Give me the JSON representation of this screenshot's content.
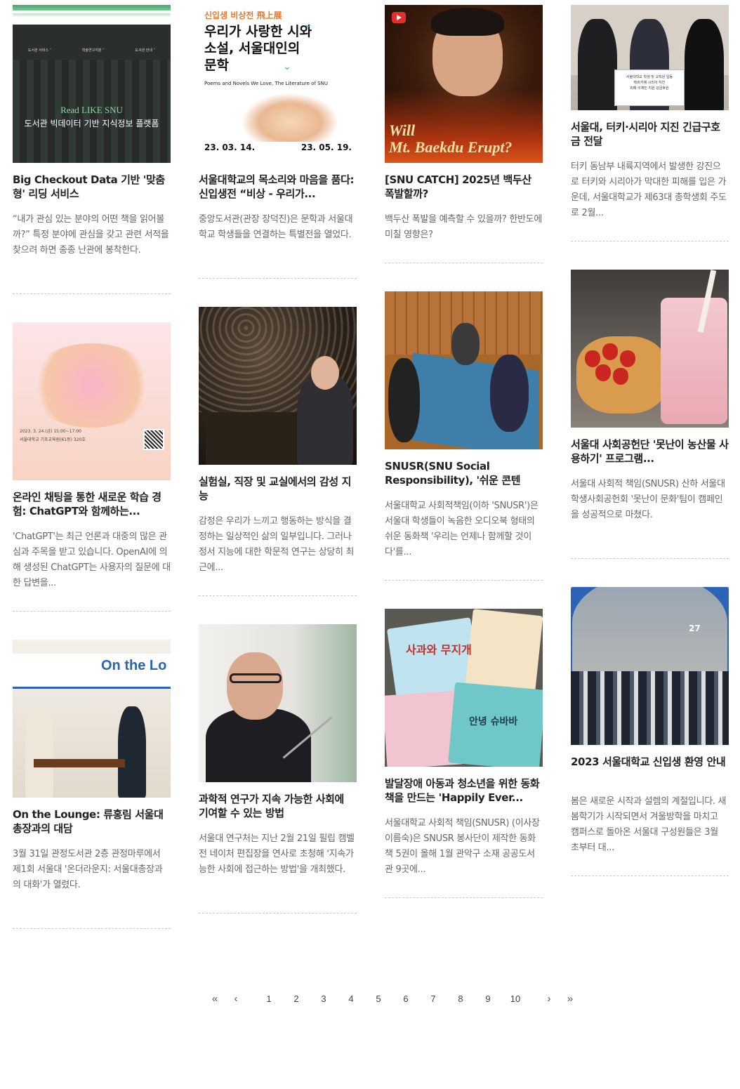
{
  "cards": [
    {
      "title": "Big Checkout Data 기반 '맞춤형' 리딩 서비스",
      "summary": "“내가 관심 있는 분야의 어떤 책을 읽어볼까?” 특정 분야에 관심을 갖고 관련 서적을 찾으려 하면 종종 난관에 봉착한다.",
      "thumb_text": {
        "nav1": "도서관 서비스 ˅",
        "nav2": "학술연구지원 ˅",
        "nav3": "도서관 안내 ˅",
        "line1": "Read LIKE SNU",
        "line2": "도서관 빅데이터 기반 지식정보 플랫폼"
      }
    },
    {
      "title": "서울대학교의 목소리와 마음을 품다: 신입생전 “비상 - 우리가...",
      "summary": "중앙도서관(관장 장덕진)은 문학과 서울대학교 학생들을 연결하는 특별전을 열었다.",
      "thumb_text": {
        "kicker": "신입생 비상전 飛上展",
        "headline": "우리가 사랑한 시와 소설, 서울대인의 문학",
        "english": "Poems and Novels We Love, The Literature of SNU",
        "date_start": "23. 03. 14.",
        "date_end": "23. 05. 19."
      }
    },
    {
      "title": "[SNU CATCH] 2025년 백두산 폭발할까?",
      "summary": "백두산 폭발을 예측할 수 있을까? 한반도에 미칠 영향은?",
      "thumb_text": {
        "line1": "Will",
        "line2": "Mt. Baekdu Erupt?"
      }
    },
    {
      "title": "서울대, 터키·시리아 지진 긴급구호금 전달",
      "summary": "터키 동남부 내륙지역에서 발생한 강진으로 터키와 시리아가 막대한 피해를 입은 가운데, 서울대학교가 제63대 총학생회 주도로 2월...",
      "thumb_text": {
        "sign1": "서울대학교 학생 및 교직원 일동",
        "sign2": "튀르키예·시리아 지진",
        "sign3": "피해 이재민 지원 성금후원"
      }
    },
    {
      "title": "온라인 채팅을 통한 새로운 학습 경험: ChatGPT와 함께하는...",
      "summary": "'ChatGPT'는 최근 언론과 대중의 많은 관심과 주목을 받고 있습니다. OpenAI에 의해 생성된 ChatGPT는 사용자의 질문에 대한 답변을...",
      "thumb_text": {
        "date": "2023. 3. 24.(금) 15:00~17:00",
        "place": "서울대학교 기초교육원(61동) 320호"
      }
    },
    {
      "title": "실험실, 직장 및 교실에서의 감성 지능",
      "summary": "감정은 우리가 느끼고 행동하는 방식을 결정하는 일상적인 삶의 일부입니다. 그러나 정서 지능에 대한 학문적 연구는 상당히 최근에...",
      "thumb_text": {}
    },
    {
      "title": "SNUSR(SNU Social Responsibility), '쉬운 콘텐츠'...",
      "summary": "서울대학교 사회적책임(이하 'SNUSR')은 서울대 학생들이 녹음한 오디오북 형태의 쉬운 동화책 '우리는 언제나 함께할 것이다'를...",
      "thumb_text": {}
    },
    {
      "title": "서울대 사회공헌단 '못난이 농산물 사용하기' 프로그램...",
      "summary": "서울대 사회적 책임(SNUSR) 산하 서울대 학생사회공헌회 '못난이 문화'팀이 캠페인을 성공적으로 마쳤다.",
      "thumb_text": {}
    },
    {
      "title": "On the Lounge: 류홍림 서울대 총장과의 대담",
      "summary": "3월 31일 관정도서관 2층 관정마루에서 제1회 서울대 '온더라운지: 서울대총장과의 대화'가 열렸다.",
      "thumb_text": {
        "banner": "On the Lo"
      }
    },
    {
      "title": "과학적 연구가 지속 가능한 사회에 기여할 수 있는 방법",
      "summary": "서울대 연구처는 지난 2월 21일 필립 캠벨 전 네이처 편집장을 연사로 초청해 '지속가능한 사회에 접근하는 방법'을 개최했다.",
      "thumb_text": {}
    },
    {
      "title": "발달장애 아동과 청소년을 위한 동화책을 만드는 'Happily Ever...",
      "summary": "서울대학교 사회적 책임(SNUSR) (이사장 이름숙)은 SNUSR 봉사단이 제작한 동화책 5권이 올해 1월 관악구 소재 공공도서관 9곳에...",
      "thumb_text": {
        "book1": "사과와 무지개",
        "book2": "안녕 슈바바"
      }
    },
    {
      "title": "2023 서울대학교 신입생 환영 안내",
      "summary": "봄은 새로운 시작과 설렘의 계절입니다. 새 봄학기가 시작되면서 겨울방학을 마치고 캠퍼스로 돌아온 서울대 구성원들은 3월 초부터 대...",
      "thumb_text": {
        "gate_number": "27"
      }
    }
  ],
  "pagination": {
    "first": "«",
    "prev": "‹",
    "pages": [
      "1",
      "2",
      "3",
      "4",
      "5",
      "6",
      "7",
      "8",
      "9",
      "10"
    ],
    "next": "›",
    "last": "»"
  },
  "colors": {
    "title": "#222222",
    "summary": "#666666",
    "divider": "#c8c8c8",
    "accent_blue": "#2b63b7"
  }
}
